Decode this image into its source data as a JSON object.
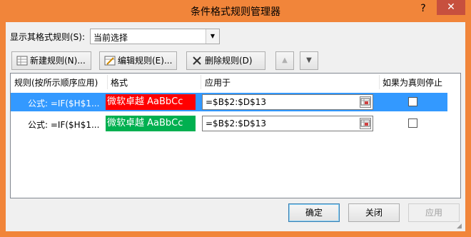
{
  "window": {
    "title": "条件格式规则管理器",
    "help_label": "?",
    "close_label": "✕",
    "accent_color": "#f1853a"
  },
  "show_rules": {
    "label": "显示其格式规则(S):",
    "selected": "当前选择"
  },
  "toolbar": {
    "new_rule": "新建规则(N)...",
    "edit_rule": "编辑规则(E)...",
    "delete_rule": "删除规则(D)",
    "move_up_icon": "triangle-up-icon",
    "move_down_icon": "triangle-down-icon"
  },
  "columns": {
    "rule": "规则(按所示顺序应用)",
    "format": "格式",
    "applies_to": "应用于",
    "stop_if_true": "如果为真则停止"
  },
  "rules": [
    {
      "formula": "公式: =IF($H$1...",
      "preview": "微软卓越  AaBbCc",
      "preview_color": "#ff0000",
      "applies_to": "=$B$2:$D$13",
      "stop_if_true": false,
      "selected": true
    },
    {
      "formula": "公式: =IF($H$1...",
      "preview": "微软卓越  AaBbCc",
      "preview_color": "#00b050",
      "applies_to": "=$B$2:$D$13",
      "stop_if_true": false,
      "selected": false
    }
  ],
  "buttons": {
    "ok": "确定",
    "close": "关闭",
    "apply": "应用"
  },
  "selection_color": "#3399ff"
}
